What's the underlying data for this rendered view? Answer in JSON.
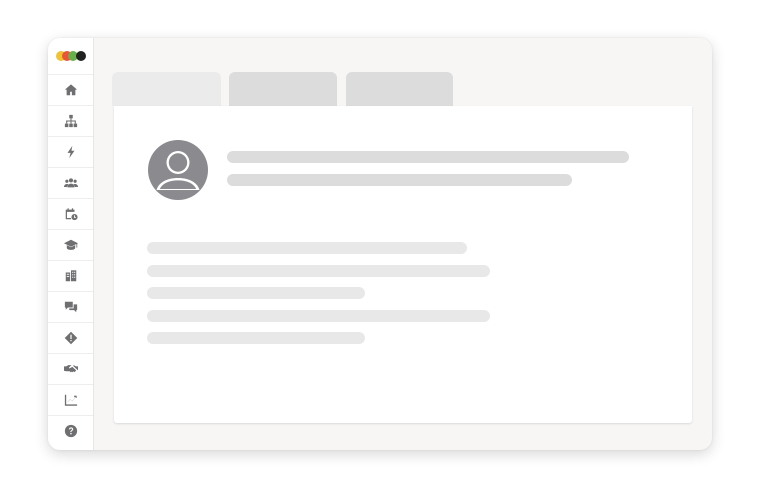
{
  "app": {
    "logo_colors": [
      "#f2c230",
      "#e8553b",
      "#6ab04c",
      "#222222"
    ]
  },
  "sidebar": {
    "icon_color": "#6f6f72",
    "items": [
      {
        "icon": "home-icon"
      },
      {
        "icon": "org-chart-icon"
      },
      {
        "icon": "lightning-icon"
      },
      {
        "icon": "users-icon"
      },
      {
        "icon": "calendar-icon"
      },
      {
        "icon": "graduation-cap-icon"
      },
      {
        "icon": "building-icon"
      },
      {
        "icon": "chat-icon"
      },
      {
        "icon": "warning-icon"
      },
      {
        "icon": "handshake-icon"
      },
      {
        "icon": "chart-icon"
      },
      {
        "icon": "help-icon"
      }
    ]
  },
  "tabs": [
    {
      "state": "active",
      "color": "#ebebeb"
    },
    {
      "state": "inactive",
      "color": "#dcdcdd"
    },
    {
      "state": "inactive",
      "color": "#dcdcdd"
    }
  ],
  "panel": {
    "avatar_icon": "user-avatar-icon",
    "avatar_color": "#8b8b8f",
    "header_placeholder_color": "#dcdcdd",
    "body_placeholder_color": "#e8e8e8",
    "placeholder_line_count": {
      "header": 2,
      "body": 5
    }
  }
}
